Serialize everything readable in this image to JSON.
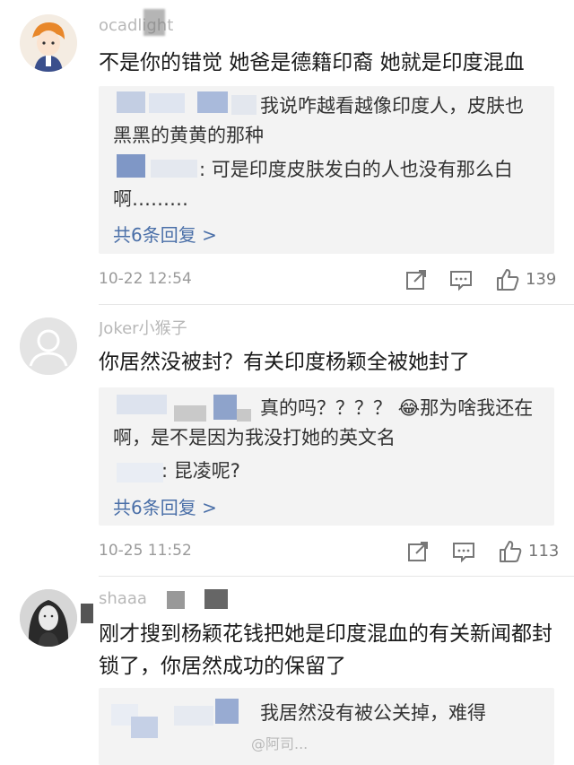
{
  "comments": [
    {
      "username_visible": "ocadlight",
      "body": "不是你的错觉 她爸是德籍印裔 她就是印度混血",
      "replies": [
        {
          "text": "我说咋越看越像印度人，皮肤也黑黑的黄黄的那种"
        },
        {
          "text": ": 可是印度皮肤发白的人也没有那么白啊………"
        }
      ],
      "more_replies": "共6条回复 >",
      "time": "10-22 12:54",
      "likes": "139"
    },
    {
      "username_visible": "Joker小猴子",
      "body": "你居然没被封？有关印度杨颖全被她封了",
      "replies": [
        {
          "text": "真的吗？？？？ 😂那为啥我还在啊，是不是因为我没打她的英文名"
        },
        {
          "text": ": 昆凌呢?"
        }
      ],
      "more_replies": "共6条回复 >",
      "time": "10-25 11:52",
      "likes": "113"
    },
    {
      "username_visible": "shaaa",
      "body": "刚才搜到杨颖花钱把她是印度混血的有关新闻都封锁了，你居然成功的保留了",
      "replies": [
        {
          "text": "我居然没有被公关掉，难得"
        }
      ],
      "partial_handle": "@阿司..."
    }
  ],
  "icons": {
    "share": "share-icon",
    "comment": "comment-icon",
    "like": "thumbs-up-icon"
  },
  "colors": {
    "link": "#4a6fa8",
    "reply_bg": "#f3f3f3",
    "meta": "#9a9a9a"
  }
}
